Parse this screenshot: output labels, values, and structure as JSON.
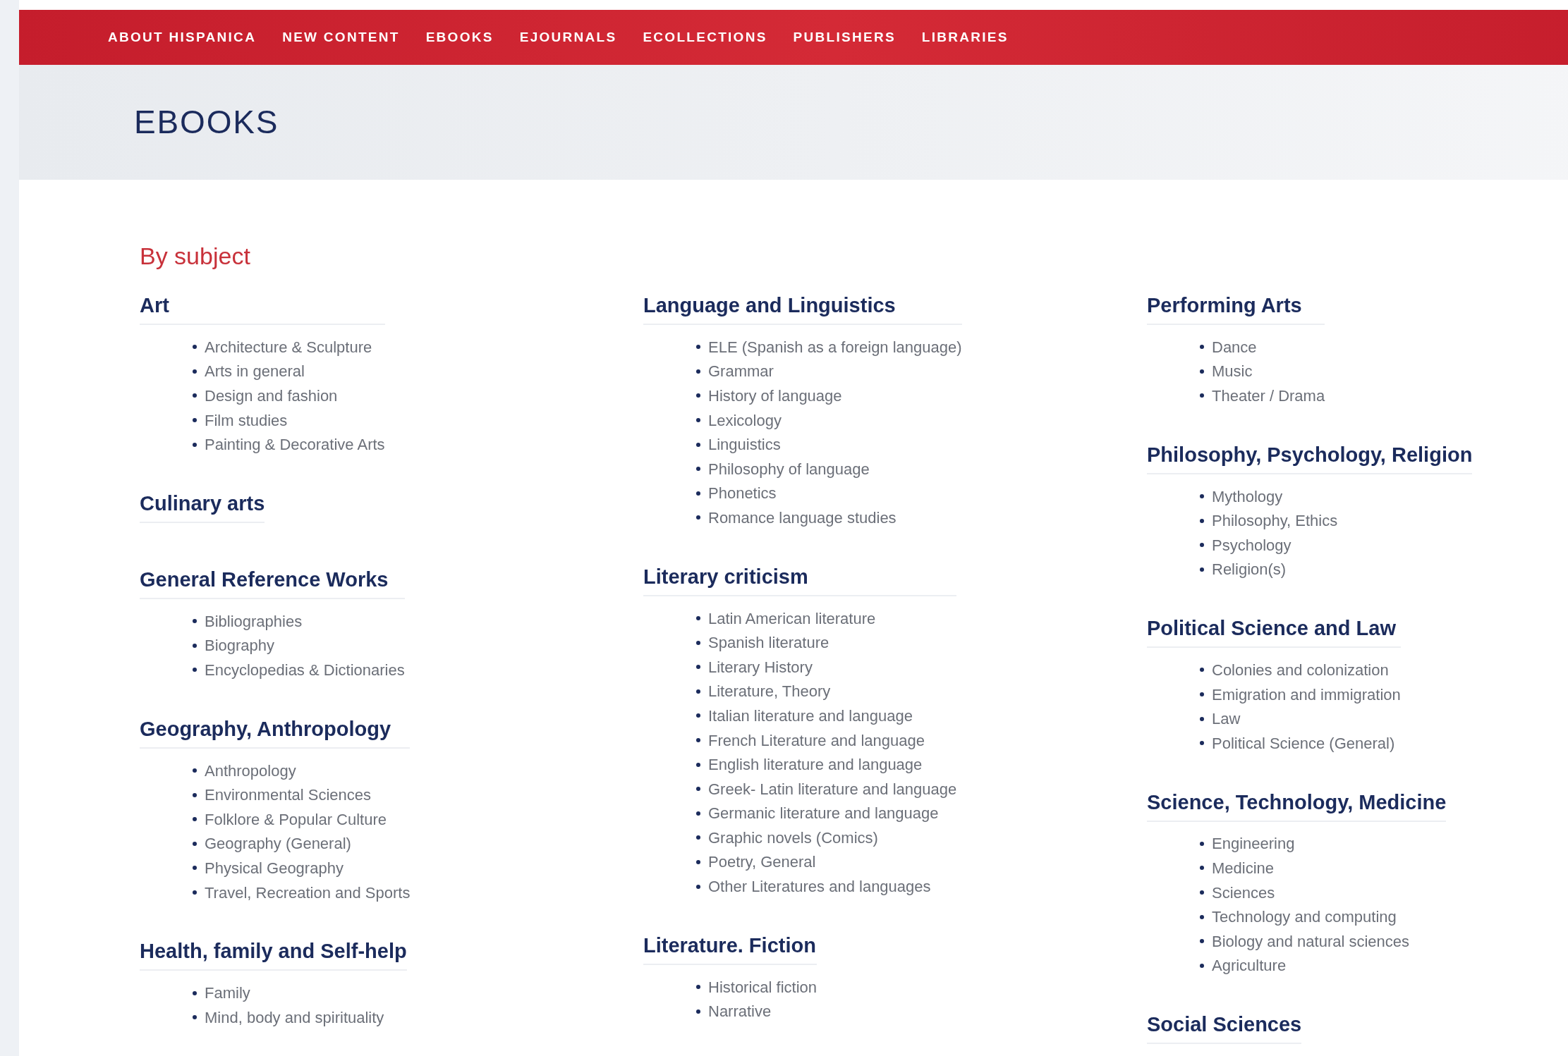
{
  "nav": {
    "items": [
      {
        "label": "ABOUT HISPANICA"
      },
      {
        "label": "NEW CONTENT"
      },
      {
        "label": "EBOOKS"
      },
      {
        "label": "EJOURNALS"
      },
      {
        "label": "ECOLLECTIONS"
      },
      {
        "label": "PUBLISHERS"
      },
      {
        "label": "LIBRARIES"
      }
    ]
  },
  "page_title": "EBOOKS",
  "section_title": "By subject",
  "columns": [
    [
      {
        "heading": "Art",
        "items": [
          "Architecture & Sculpture",
          "Arts in general",
          "Design and fashion",
          "Film studies",
          "Painting & Decorative Arts"
        ]
      },
      {
        "heading": "Culinary arts"
      },
      {
        "heading": "General Reference Works",
        "items": [
          "Bibliographies",
          "Biography",
          "Encyclopedias & Dictionaries"
        ]
      },
      {
        "heading": "Geography, Anthropology",
        "items": [
          "Anthropology",
          "Environmental Sciences",
          "Folklore & Popular Culture",
          "Geography (General)",
          "Physical Geography",
          "Travel, Recreation and Sports"
        ]
      },
      {
        "heading": "Health, family and Self-help",
        "items": [
          "Family",
          "Mind, body and spirituality"
        ]
      }
    ],
    [
      {
        "heading": "Language and Linguistics",
        "items": [
          "ELE (Spanish as a foreign language)",
          "Grammar",
          "History of language",
          "Lexicology",
          "Linguistics",
          "Philosophy of language",
          "Phonetics",
          "Romance language studies"
        ]
      },
      {
        "heading": "Literary criticism",
        "items": [
          "Latin American literature",
          "Spanish literature",
          "Literary History",
          "Literature, Theory",
          "Italian literature and language",
          "French Literature and language",
          "English literature and language",
          "Greek- Latin literature and language",
          "Germanic literature and language",
          "Graphic novels (Comics)",
          "Poetry, General",
          "Other Literatures and languages"
        ]
      },
      {
        "heading": "Literature. Fiction",
        "items": [
          "Historical fiction",
          "Narrative"
        ]
      }
    ],
    [
      {
        "heading": "Performing Arts",
        "items": [
          "Dance",
          "Music",
          "Theater / Drama"
        ]
      },
      {
        "heading": "Philosophy, Psychology, Religion",
        "items": [
          "Mythology",
          "Philosophy, Ethics",
          "Psychology",
          "Religion(s)"
        ]
      },
      {
        "heading": "Political Science and Law",
        "items": [
          "Colonies and colonization",
          "Emigration and immigration",
          "Law",
          "Political Science (General)"
        ]
      },
      {
        "heading": "Science, Technology, Medicine",
        "items": [
          "Engineering",
          "Medicine",
          "Sciences",
          "Technology and computing",
          "Biology and natural sciences",
          "Agriculture"
        ]
      },
      {
        "heading": "Social Sciences"
      }
    ]
  ]
}
